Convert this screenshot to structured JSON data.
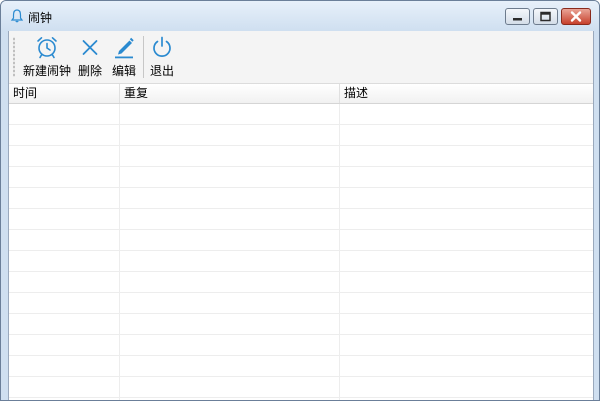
{
  "window": {
    "title": "闹钟"
  },
  "toolbar": {
    "new_alarm": "新建闹钟",
    "delete": "删除",
    "edit": "编辑",
    "exit": "退出"
  },
  "table": {
    "columns": [
      "时间",
      "重复",
      "描述"
    ],
    "rows": []
  },
  "colors": {
    "accent": "#2a8ad0"
  }
}
